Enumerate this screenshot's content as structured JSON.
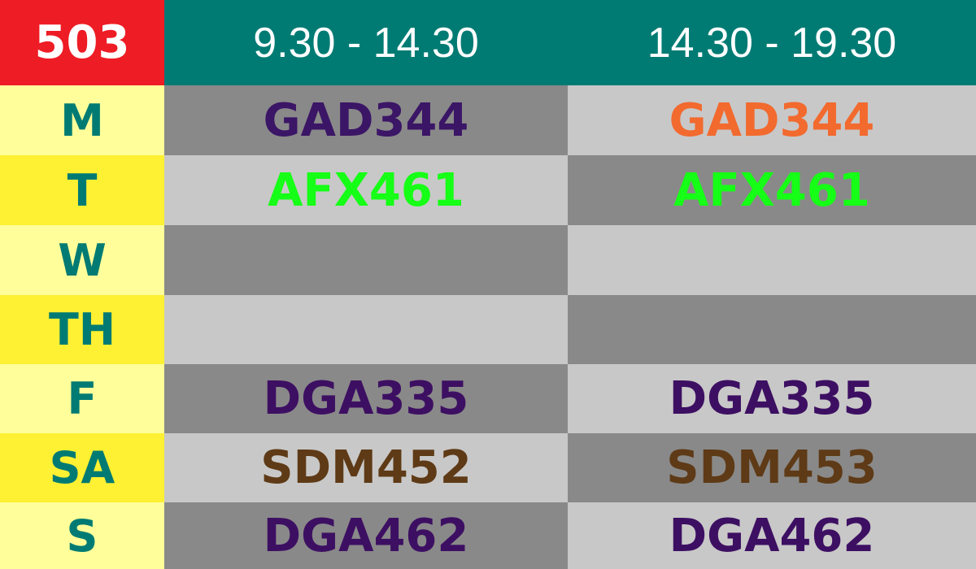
{
  "header": {
    "room": "503",
    "slots": [
      "9.30  -  14.30",
      "14.30  -  19.30"
    ]
  },
  "colors": {
    "room_bg": "#ee1c25",
    "header_bg": "#007b73",
    "day_text": "#007b73",
    "day_light_bg": "#fffe9a",
    "day_dark_bg": "#fef032",
    "cell_dark_bg": "#898989",
    "cell_light_bg": "#c8c8c8"
  },
  "rows": [
    {
      "day": "M",
      "cells": [
        {
          "code": "GAD344",
          "color": "#3b1566"
        },
        {
          "code": "GAD344",
          "color": "#f26a2e"
        }
      ]
    },
    {
      "day": "T",
      "cells": [
        {
          "code": "AFX461",
          "color": "#16ff16"
        },
        {
          "code": "AFX461",
          "color": "#16ff16"
        }
      ]
    },
    {
      "day": "W",
      "cells": [
        {
          "code": "",
          "color": ""
        },
        {
          "code": "",
          "color": ""
        }
      ]
    },
    {
      "day": "TH",
      "cells": [
        {
          "code": "",
          "color": ""
        },
        {
          "code": "",
          "color": ""
        }
      ]
    },
    {
      "day": "F",
      "cells": [
        {
          "code": "DGA335",
          "color": "#3d0f62"
        },
        {
          "code": "DGA335",
          "color": "#3d0f62"
        }
      ]
    },
    {
      "day": "SA",
      "cells": [
        {
          "code": "SDM452",
          "color": "#5e3a16"
        },
        {
          "code": "SDM453",
          "color": "#5e3a16"
        }
      ]
    },
    {
      "day": "S",
      "cells": [
        {
          "code": "DGA462",
          "color": "#3d0f62"
        },
        {
          "code": "DGA462",
          "color": "#3d0f62"
        }
      ]
    }
  ]
}
